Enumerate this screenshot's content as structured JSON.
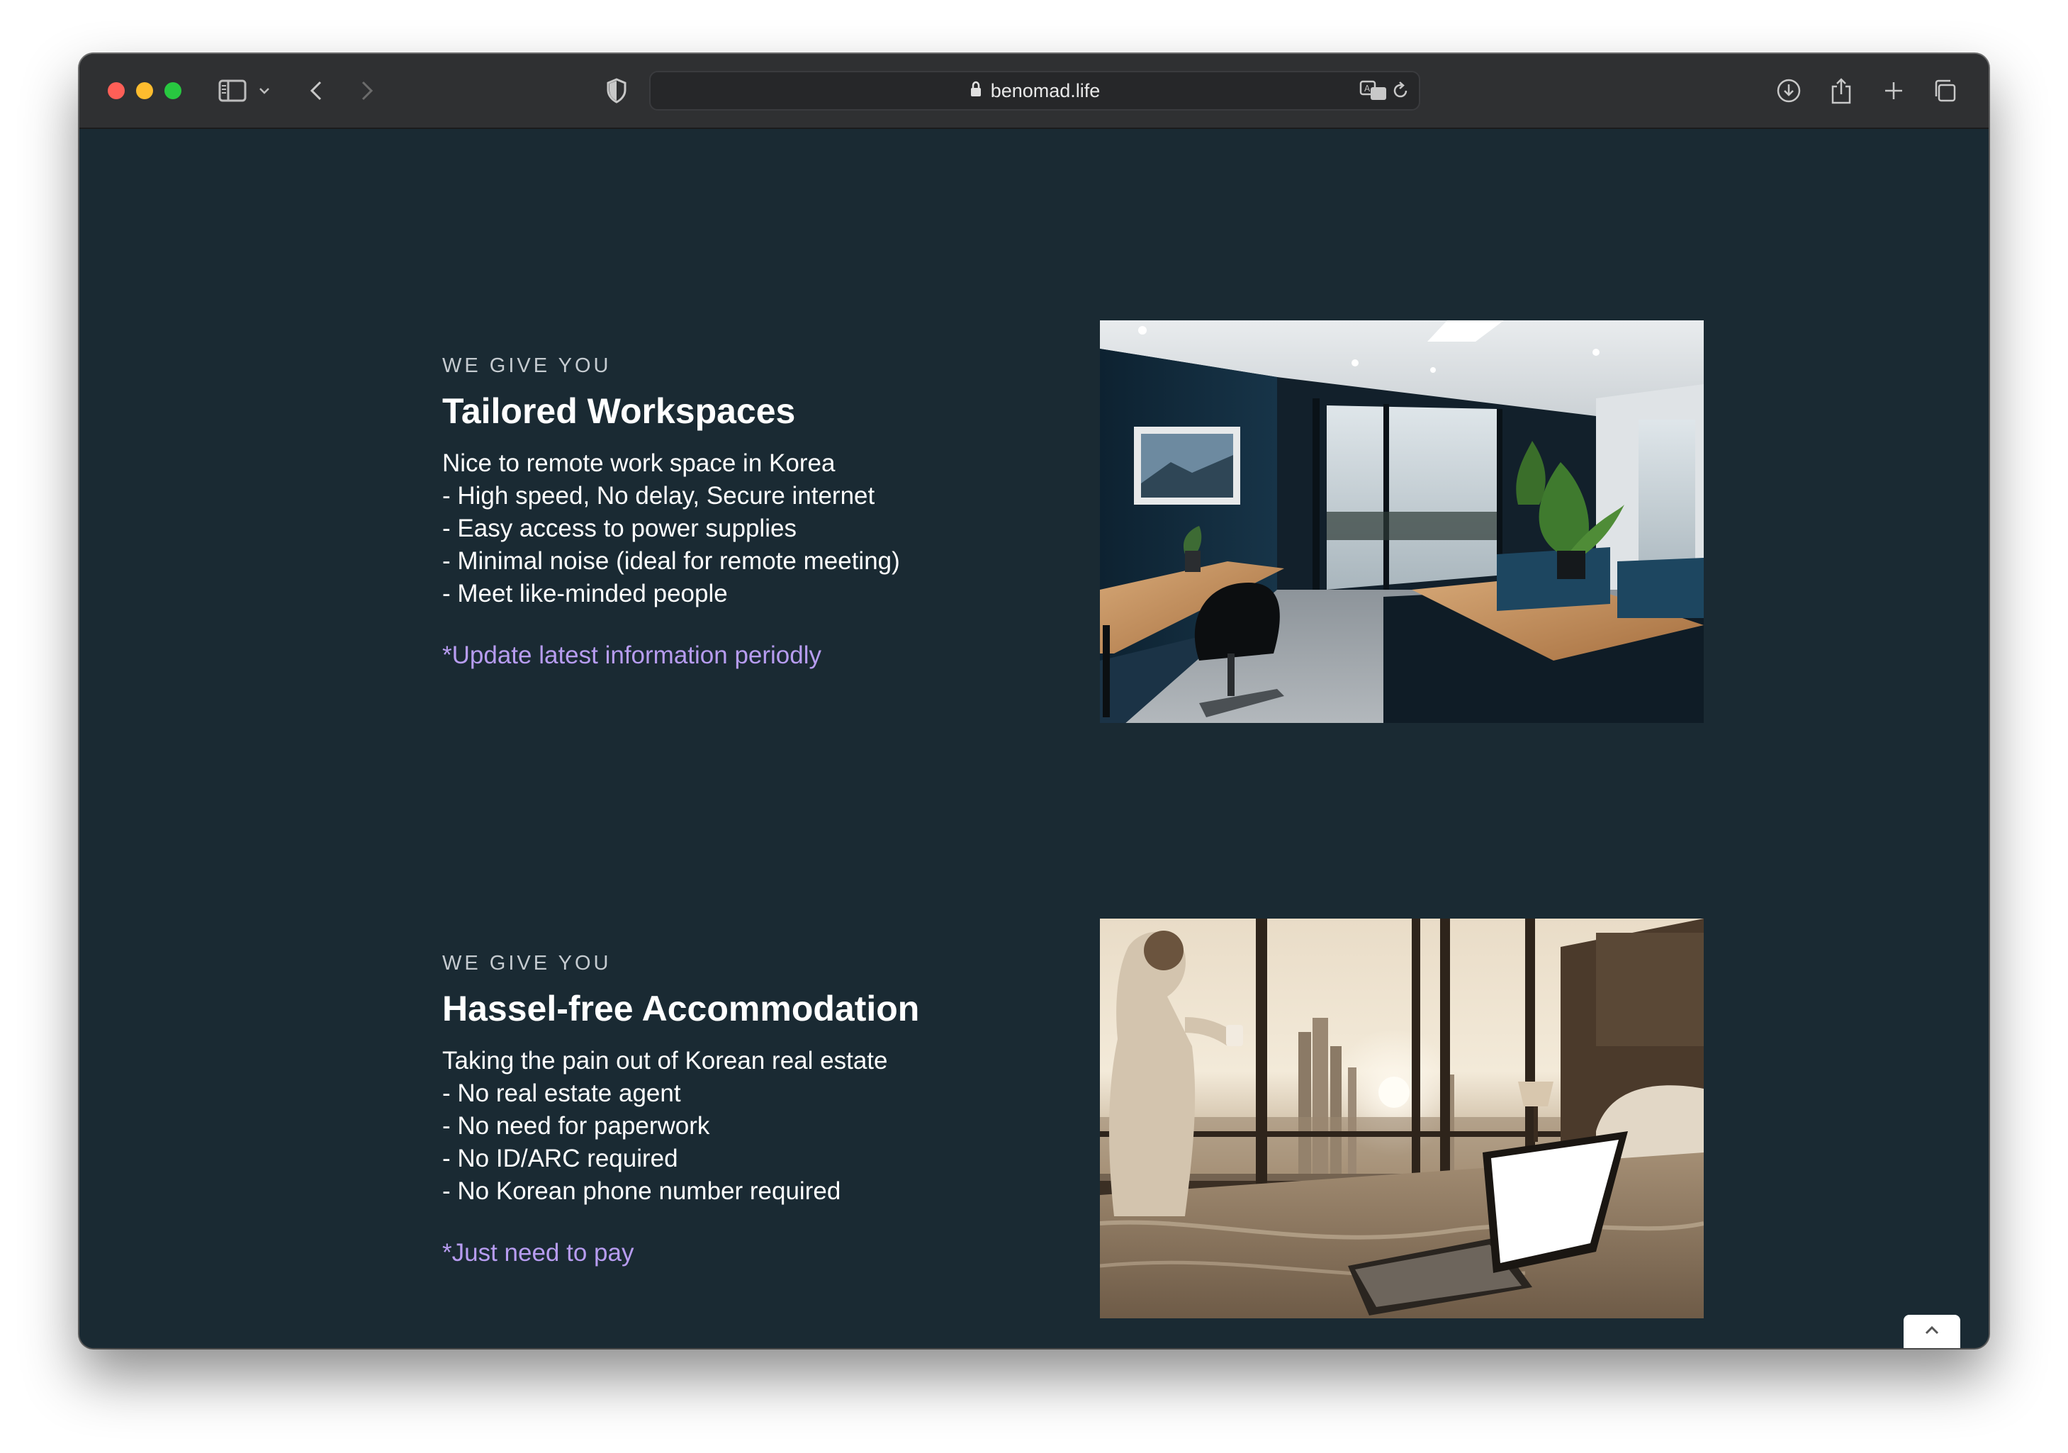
{
  "browser": {
    "url": "benomad.life"
  },
  "sections": [
    {
      "eyebrow": "WE GIVE YOU",
      "title": "Tailored Workspaces",
      "lines": [
        "Nice to remote work space in Korea",
        "- High speed, No delay, Secure internet",
        "- Easy access to power supplies",
        "- Minimal noise (ideal for remote meeting)",
        "- Meet like-minded people"
      ],
      "note": "*Update latest information periodly"
    },
    {
      "eyebrow": "WE GIVE YOU",
      "title": "Hassel-free Accommodation",
      "lines": [
        "Taking the pain out of Korean real estate",
        "- No real estate agent",
        "- No need for paperwork",
        "- No ID/ARC required",
        "- No Korean phone number required"
      ],
      "note": "*Just need to pay"
    }
  ],
  "colors": {
    "page_background": "#1a2a33",
    "accent_note": "#b79cf0",
    "titlebar": "#2f3032"
  },
  "icons": {
    "titlebar_left": [
      "sidebar-icon",
      "chevron-down-icon",
      "back-icon",
      "forward-icon",
      "shield-icon"
    ],
    "urlbar": [
      "lock-icon",
      "translate-icon",
      "reload-icon"
    ],
    "titlebar_right": [
      "download-icon",
      "share-icon",
      "new-tab-icon",
      "tab-overview-icon"
    ],
    "page": [
      "chevron-up-icon"
    ]
  }
}
